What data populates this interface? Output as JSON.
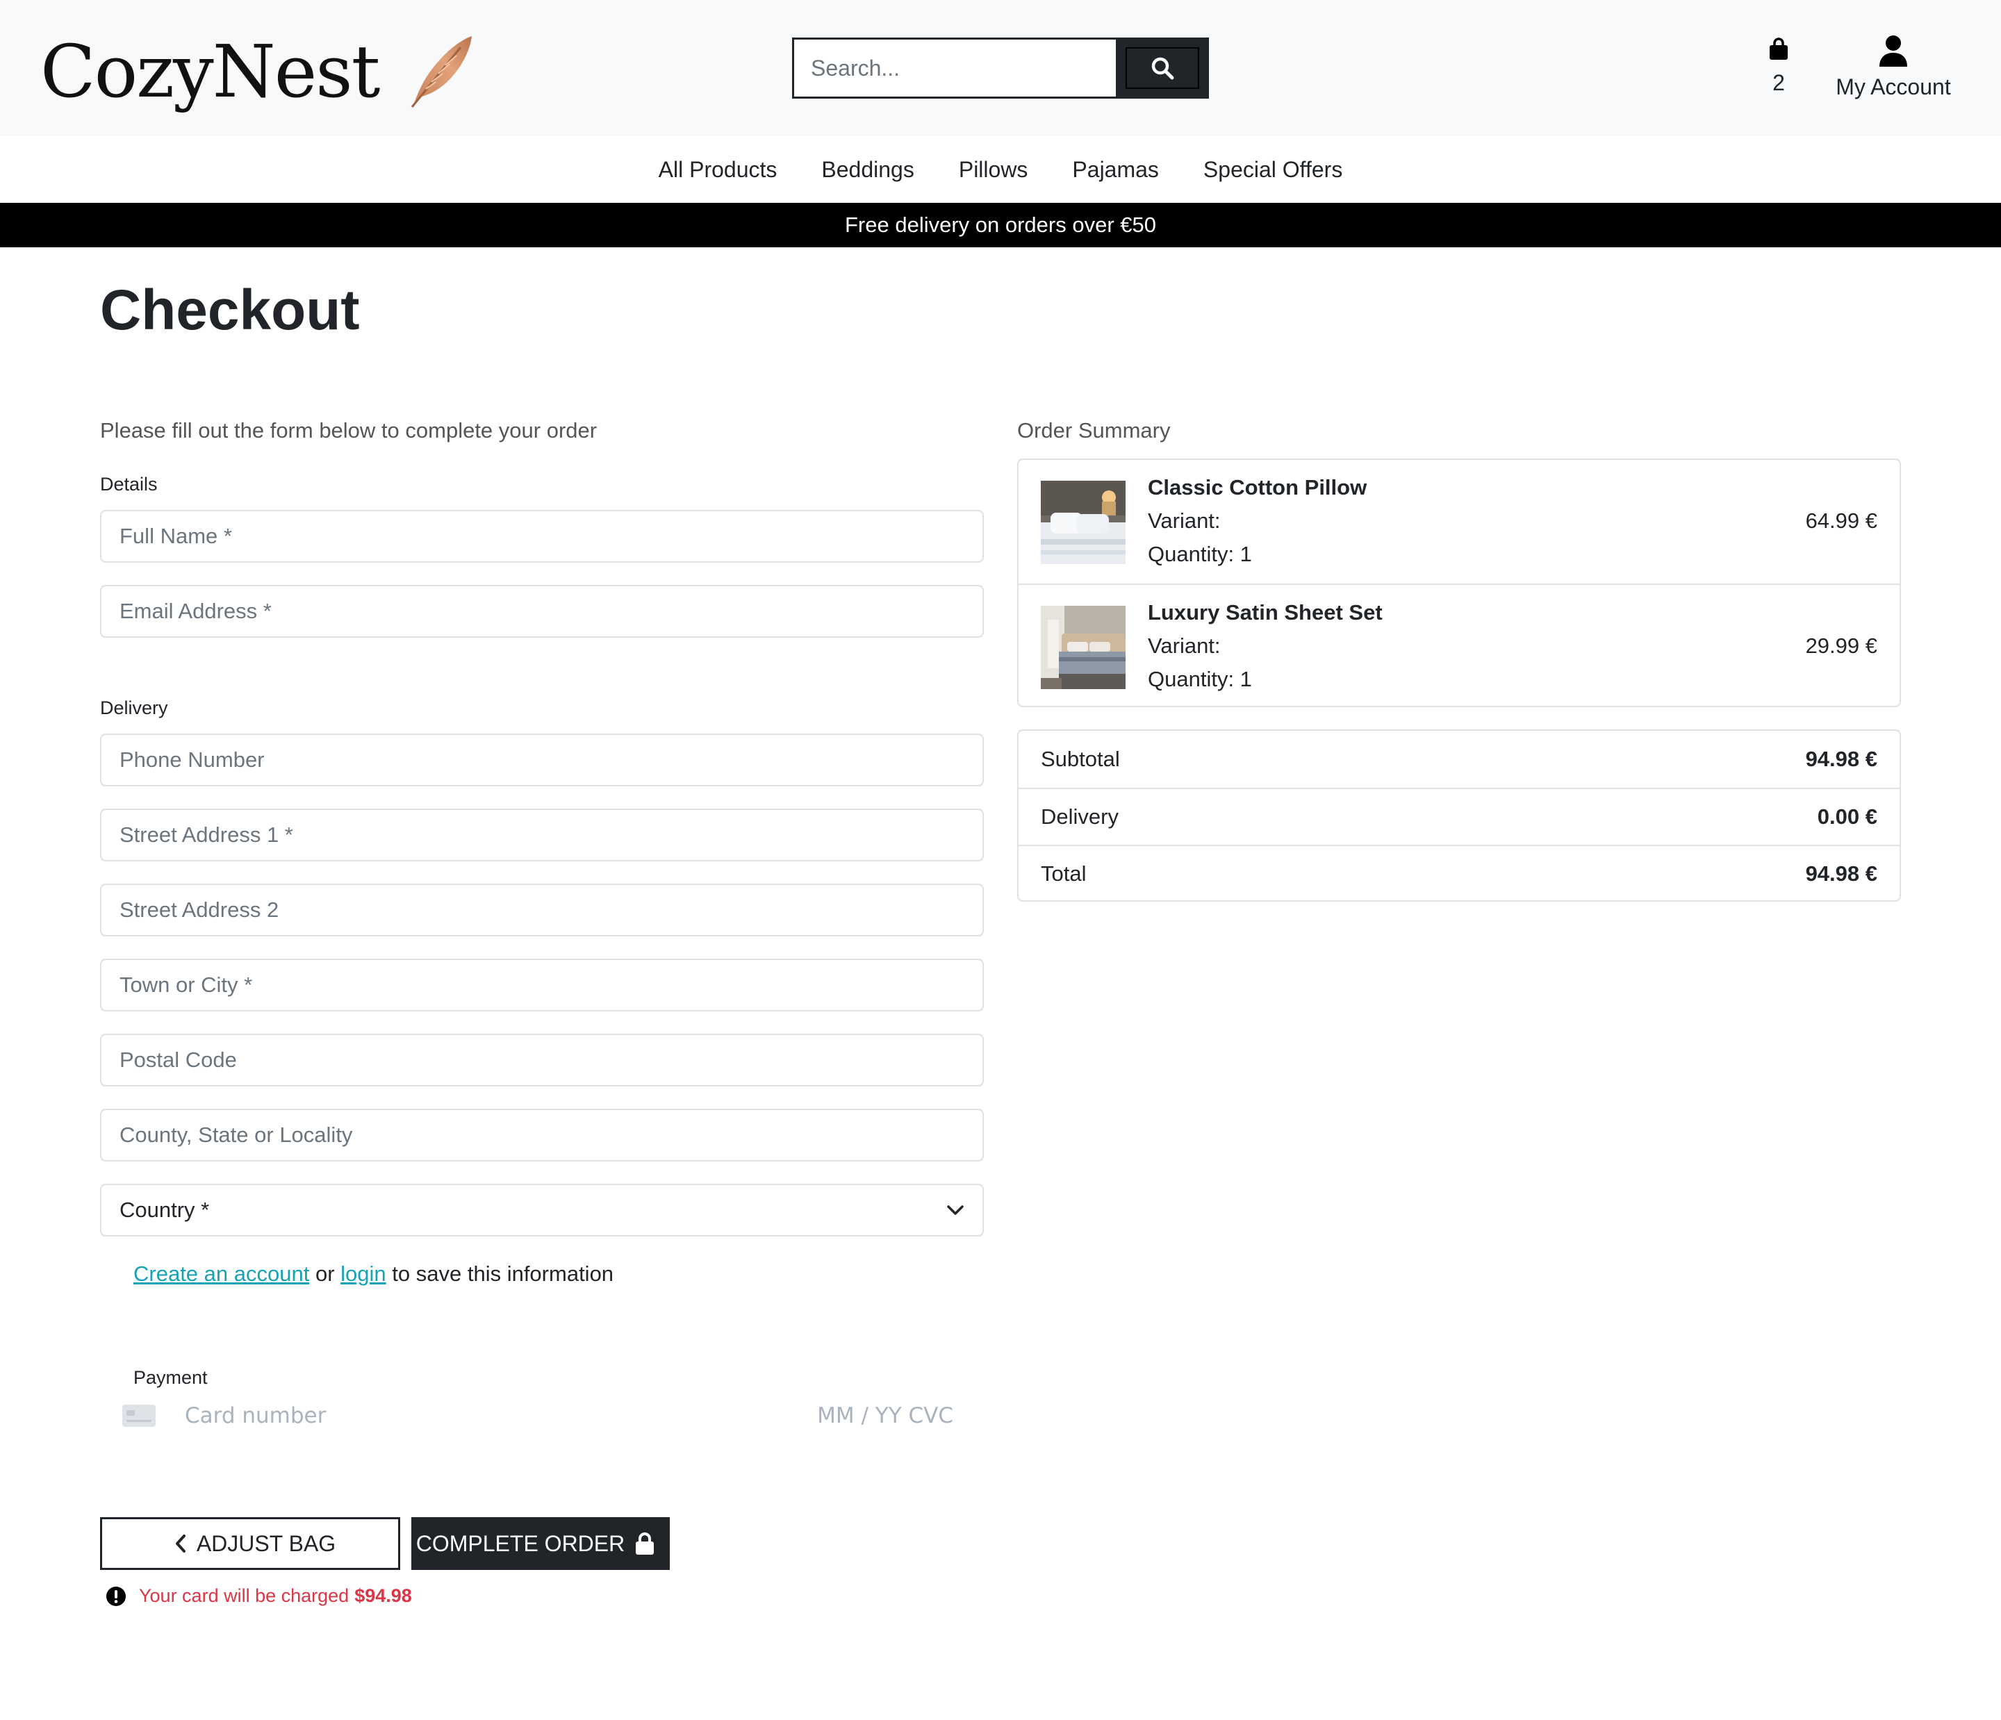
{
  "brand": {
    "name": "CozyNest"
  },
  "search": {
    "placeholder": "Search..."
  },
  "header": {
    "bag_count": "2",
    "account_label": "My Account"
  },
  "nav": {
    "items": [
      "All Products",
      "Beddings",
      "Pillows",
      "Pajamas",
      "Special Offers"
    ]
  },
  "banner": {
    "text": "Free delivery on orders over €50"
  },
  "page": {
    "title": "Checkout",
    "intro": "Please fill out the form below to complete your order"
  },
  "form": {
    "details_label": "Details",
    "full_name_placeholder": "Full Name *",
    "email_placeholder": "Email Address *",
    "delivery_label": "Delivery",
    "phone_placeholder": "Phone Number",
    "street1_placeholder": "Street Address 1 *",
    "street2_placeholder": "Street Address 2",
    "town_placeholder": "Town or City *",
    "postal_placeholder": "Postal Code",
    "county_placeholder": "County, State or Locality",
    "country_value": "Country *",
    "create_account_link": "Create an account",
    "or_text": "or",
    "login_link": "login",
    "save_info_text": "to save this information",
    "payment_label": "Payment",
    "card_number_placeholder": "Card number",
    "card_exp_cvc_placeholder": "MM / YY  CVC"
  },
  "actions": {
    "adjust_bag": "ADJUST BAG",
    "complete_order": "COMPLETE ORDER",
    "charge_text": "Your card will be charged",
    "charge_amount": "$94.98"
  },
  "summary": {
    "title": "Order Summary",
    "items": [
      {
        "name": "Classic Cotton Pillow",
        "variant": "Variant:",
        "quantity": "Quantity: 1",
        "price": "64.99 €"
      },
      {
        "name": "Luxury Satin Sheet Set",
        "variant": "Variant:",
        "quantity": "Quantity: 1",
        "price": "29.99 €"
      }
    ],
    "subtotal_label": "Subtotal",
    "subtotal_value": "94.98 €",
    "delivery_label": "Delivery",
    "delivery_value": "0.00 €",
    "total_label": "Total",
    "total_value": "94.98 €"
  },
  "colors": {
    "dark": "#212529",
    "link": "#17a2b8",
    "error": "#dc3545",
    "header_bg": "#f8f9fa"
  }
}
